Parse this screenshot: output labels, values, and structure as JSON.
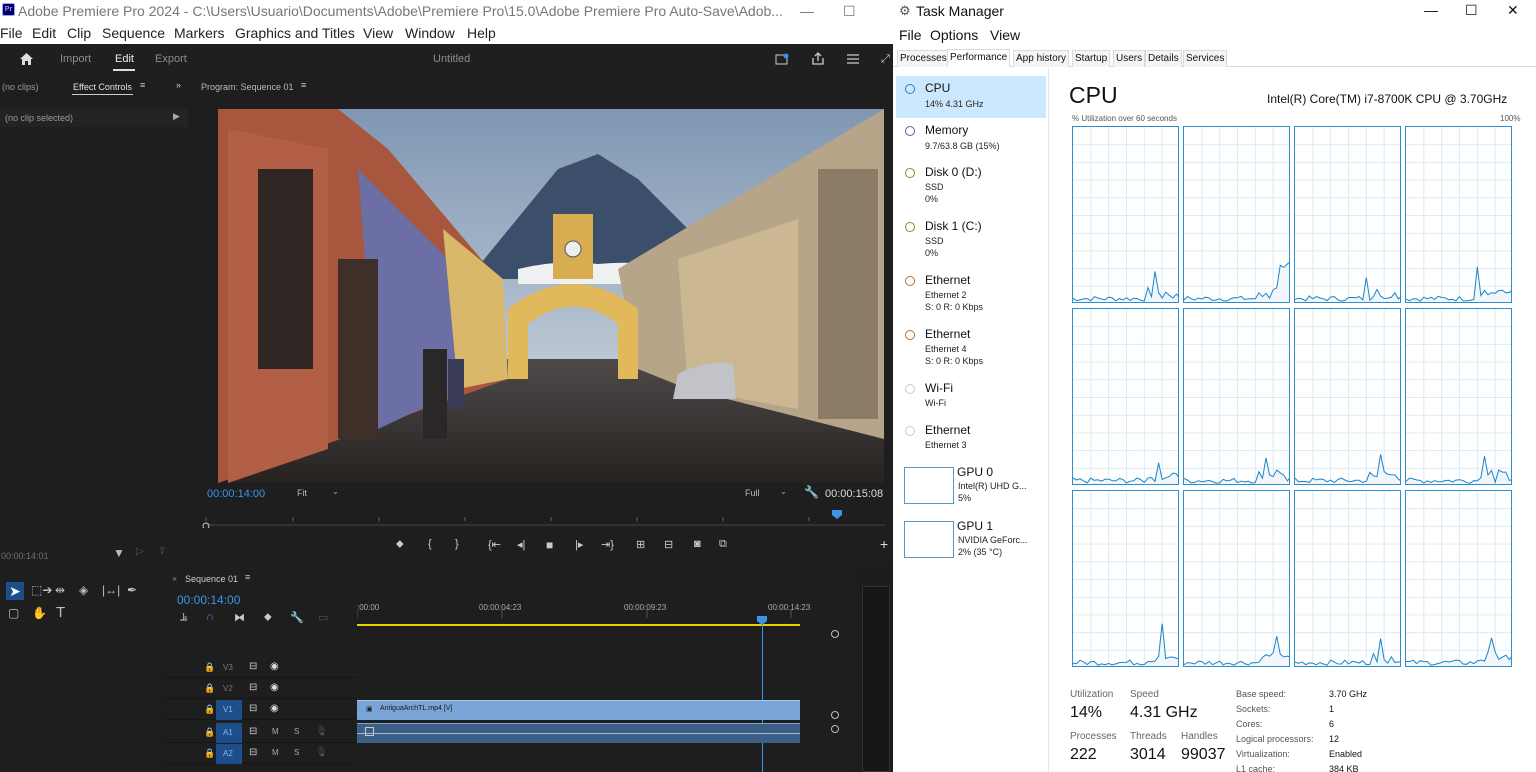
{
  "premiere": {
    "title": "Adobe Premiere Pro 2024 - C:\\Users\\Usuario\\Documents\\Adobe\\Premiere Pro\\15.0\\Adobe Premiere Pro Auto-Save\\Adob...",
    "logo": "Pr",
    "menu": [
      "File",
      "Edit",
      "Clip",
      "Sequence",
      "Markers",
      "Graphics and Titles",
      "View",
      "Window",
      "Help"
    ],
    "workspace": {
      "import": "Import",
      "edit": "Edit",
      "export": "Export",
      "doc_title": "Untitled"
    },
    "left_panel": {
      "tab_noclips": "(no clips)",
      "tab_effect_controls": "Effect Controls",
      "no_clip_selected": "(no clip selected)",
      "timecode": "00:00:14:01"
    },
    "program": {
      "tab": "Program: Sequence 01",
      "timecode": "00:00:14:00",
      "fit": "Fit",
      "quality": "Full",
      "duration": "00:00:15:08"
    },
    "timeline": {
      "tab": "Sequence 01",
      "timecode": "00:00:14:00",
      "ruler": [
        ":00:00",
        "00:00:04:23",
        "00:00:09:23",
        "00:00:14:23"
      ],
      "tracks": [
        {
          "name": "V3"
        },
        {
          "name": "V2"
        },
        {
          "name": "V1"
        },
        {
          "name": "A1"
        },
        {
          "name": "A2"
        }
      ],
      "clip_name": "AntiguaArchTL.mp4 [V]",
      "audio_m": "M",
      "audio_s": "S"
    }
  },
  "taskmanager": {
    "title": "Task Manager",
    "menu": [
      "File",
      "Options",
      "View"
    ],
    "tabs": [
      "Processes",
      "Performance",
      "App history",
      "Startup",
      "Users",
      "Details",
      "Services"
    ],
    "active_tab": "Performance",
    "sidebar": [
      {
        "name": "CPU",
        "lines": [
          "14% 4.31 GHz"
        ],
        "color": "#2a82c6"
      },
      {
        "name": "Memory",
        "lines": [
          "9.7/63.8 GB (15%)"
        ],
        "color": "#5b5ea6"
      },
      {
        "name": "Disk 0 (D:)",
        "lines": [
          "SSD",
          "0%"
        ],
        "color": "#6a9a2d"
      },
      {
        "name": "Disk 1 (C:)",
        "lines": [
          "SSD",
          "0%"
        ],
        "color": "#6a9a2d"
      },
      {
        "name": "Ethernet",
        "lines": [
          "Ethernet 2",
          "S: 0 R: 0 Kbps"
        ],
        "color": "#b8702a"
      },
      {
        "name": "Ethernet",
        "lines": [
          "Ethernet 4",
          "S: 0 R: 0 Kbps"
        ],
        "color": "#b8702a"
      },
      {
        "name": "Wi-Fi",
        "lines": [
          "Wi-Fi"
        ],
        "color": "#c9c9c9"
      },
      {
        "name": "Ethernet",
        "lines": [
          "Ethernet 3"
        ],
        "color": "#c9c9c9"
      },
      {
        "name": "GPU 0",
        "lines": [
          "Intel(R) UHD G...",
          "5%"
        ]
      },
      {
        "name": "GPU 1",
        "lines": [
          "NVIDIA GeForc...",
          "2% (35 °C)"
        ]
      }
    ],
    "cpu": {
      "title": "CPU",
      "model": "Intel(R) Core(TM) i7-8700K CPU @ 3.70GHz",
      "graph_label": "% Utilization over 60 seconds",
      "graph_max": "100%"
    },
    "stats": {
      "utilization_label": "Utilization",
      "utilization": "14%",
      "speed_label": "Speed",
      "speed": "4.31 GHz",
      "processes_label": "Processes",
      "processes": "222",
      "threads_label": "Threads",
      "threads": "3014",
      "handles_label": "Handles",
      "handles": "99037"
    },
    "specs": [
      {
        "k": "Base speed:",
        "v": "3.70 GHz"
      },
      {
        "k": "Sockets:",
        "v": "1"
      },
      {
        "k": "Cores:",
        "v": "6"
      },
      {
        "k": "Logical processors:",
        "v": "12"
      },
      {
        "k": "Virtualization:",
        "v": "Enabled"
      },
      {
        "k": "L1 cache:",
        "v": "384 KB"
      }
    ]
  }
}
